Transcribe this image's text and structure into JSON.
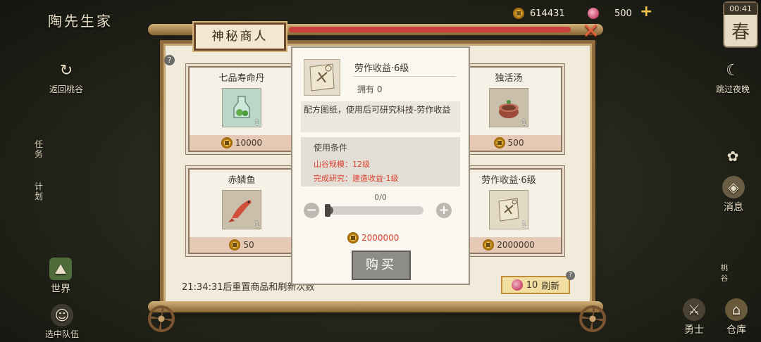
{
  "hud": {
    "player_name": "陶先生家",
    "gold": "614431",
    "gems": "500",
    "time": "00:41",
    "season": "春"
  },
  "left_menu": {
    "return_label": "返回桃谷",
    "task_label": "任务",
    "plan_label": "计划",
    "world_label": "世界",
    "team_label": "选中队伍"
  },
  "right_menu": {
    "skip_night_label": "跳过夜晚",
    "news_label": "消息",
    "peach_label": "桃谷",
    "hero_label": "勇士",
    "warehouse_label": "仓库"
  },
  "shop": {
    "title": "神秘商人",
    "items": [
      {
        "name": "七品寿命丹",
        "qty": "1",
        "price": "10000"
      },
      {
        "name": "独活汤",
        "qty": "1",
        "price": "500"
      },
      {
        "name": "赤鳞鱼",
        "qty": "1",
        "price": "50"
      },
      {
        "name": "劳作收益·6级",
        "qty": "1",
        "price": "2000000"
      }
    ],
    "reset_timer": "21:34:31后重置商品和刷新次数",
    "refresh_count": "10",
    "refresh_label": "刷新"
  },
  "popup": {
    "title": "劳作收益·6级",
    "owned": "拥有 0",
    "description": "配方图纸，使用后可研究科技-劳作收益",
    "conditions_header": "使用条件",
    "condition_1": "山谷规模：12级",
    "condition_2": "完成研究：建造收益·1级",
    "quantity": "0/0",
    "slider_fraction": 0,
    "price": "2000000",
    "buy_label": "购买"
  }
}
